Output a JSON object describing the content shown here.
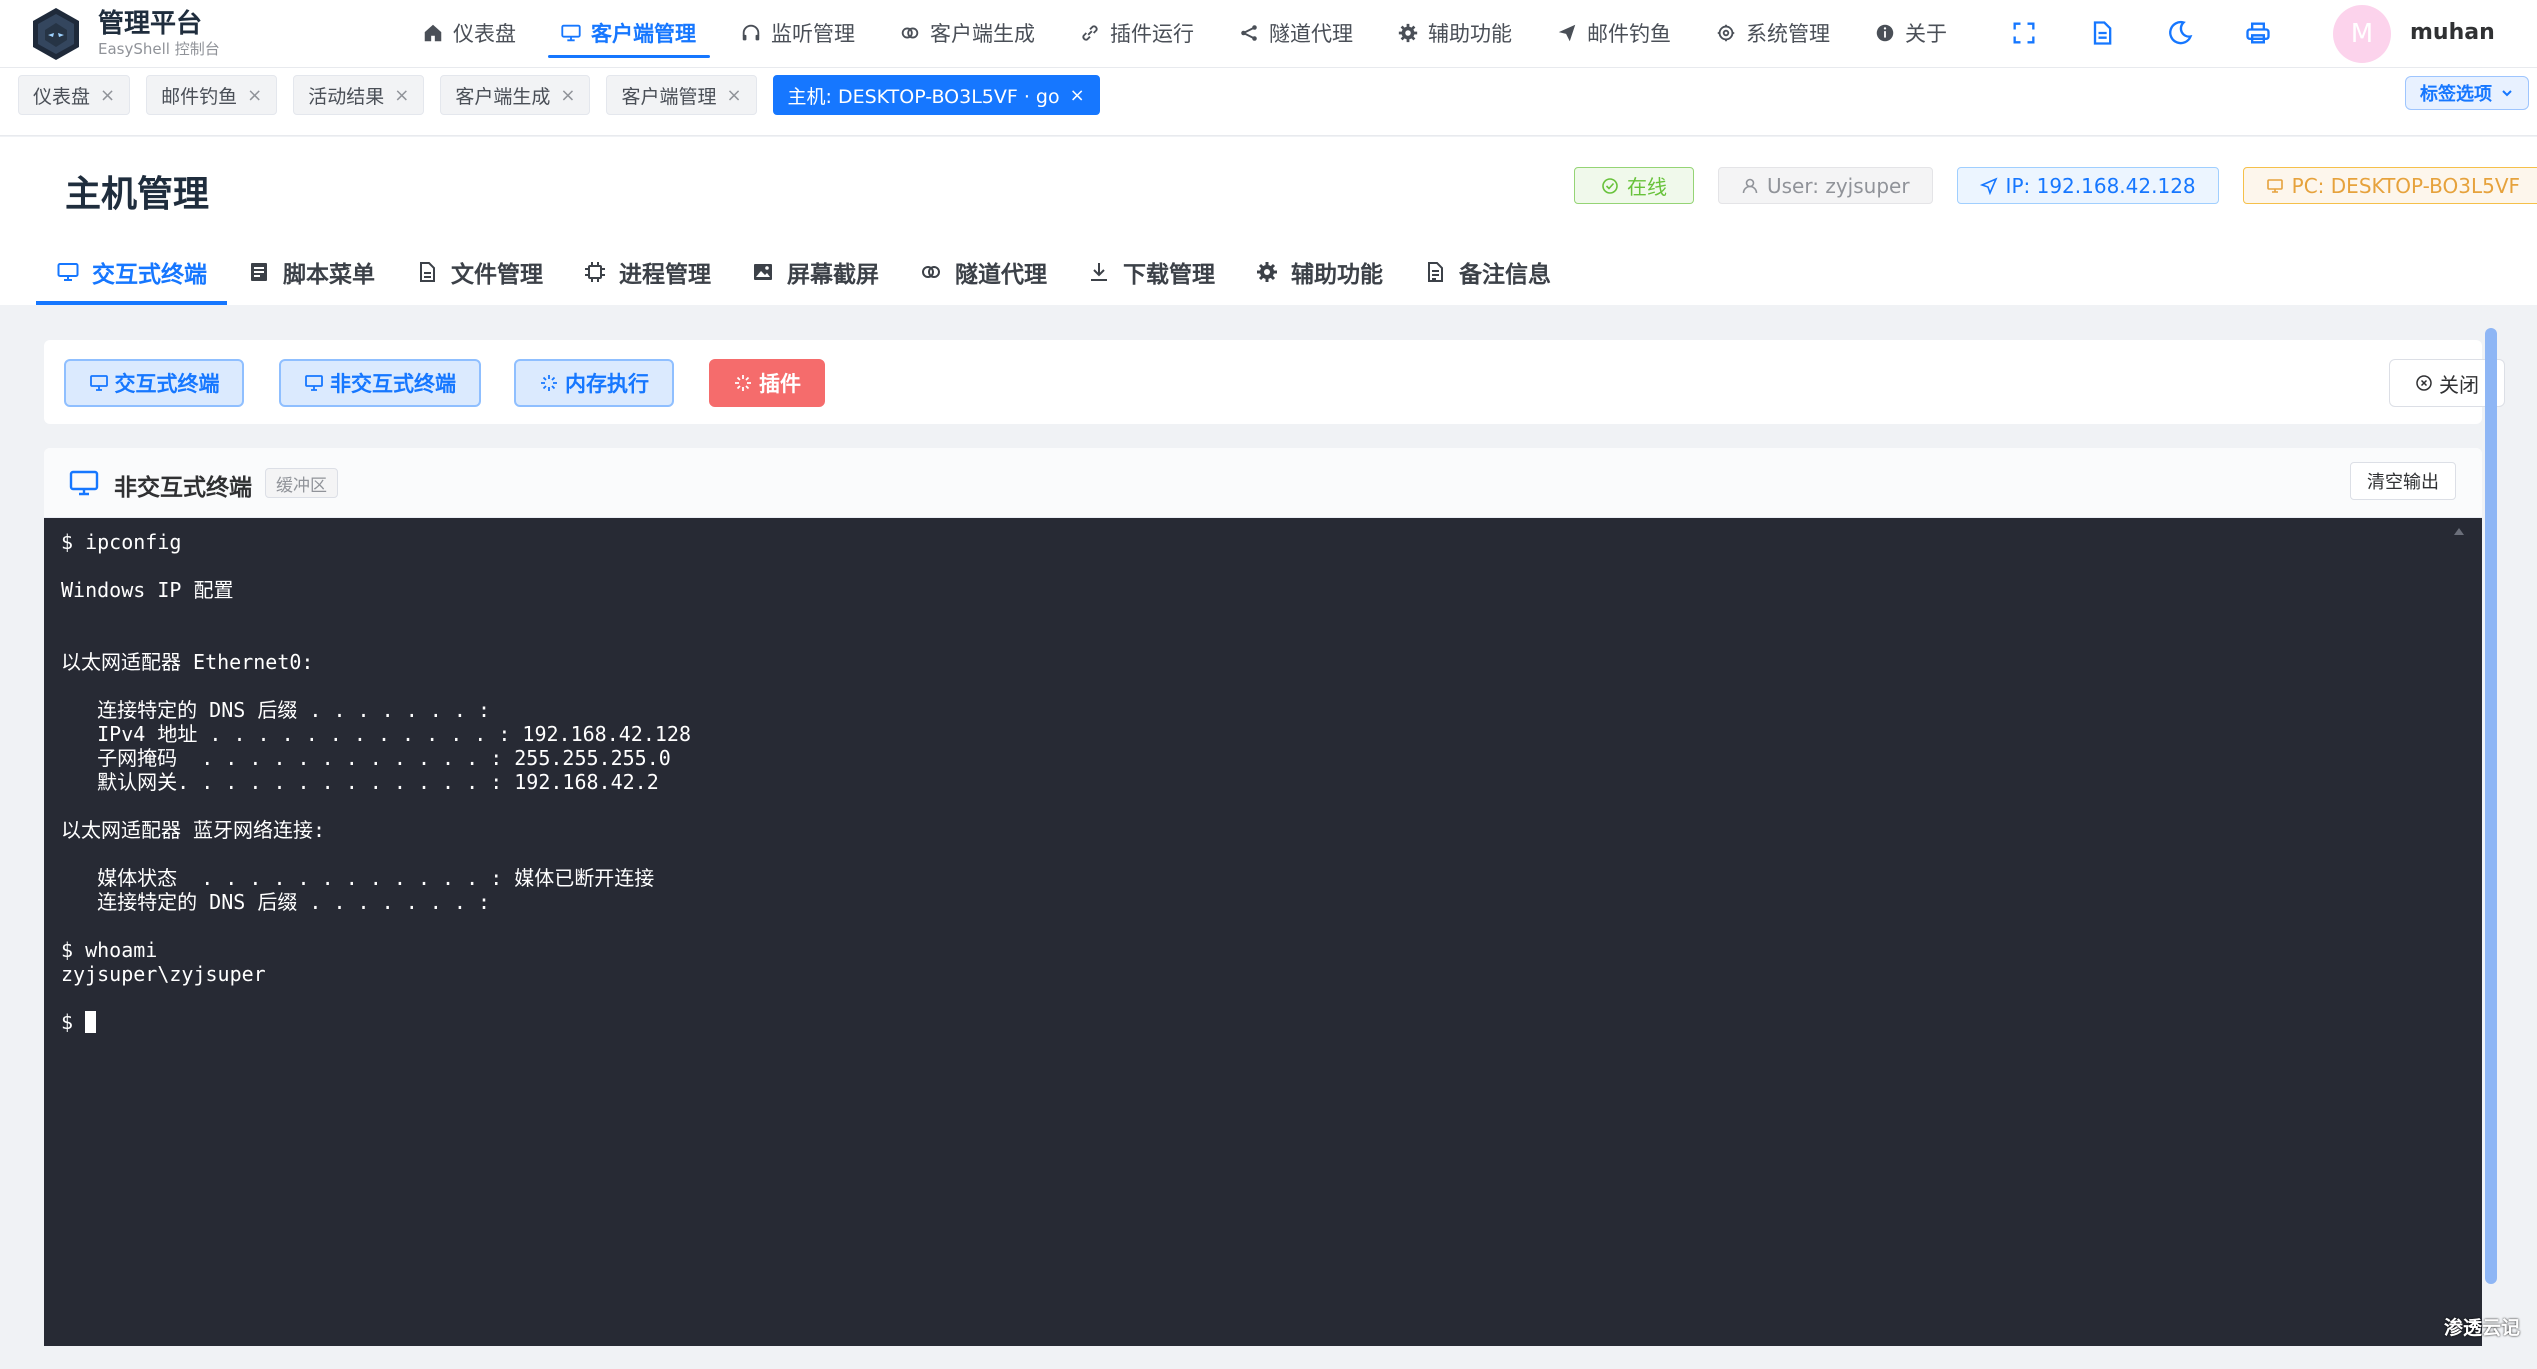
{
  "brand": {
    "title": "管理平台",
    "subtitle": "EasyShell 控制台"
  },
  "nav": [
    {
      "label": "仪表盘",
      "icon": "home-icon"
    },
    {
      "label": "客户端管理",
      "icon": "monitor-icon",
      "active": true
    },
    {
      "label": "监听管理",
      "icon": "headset-icon"
    },
    {
      "label": "客户端生成",
      "icon": "link-chain-icon"
    },
    {
      "label": "插件运行",
      "icon": "link-icon"
    },
    {
      "label": "隧道代理",
      "icon": "share-icon"
    },
    {
      "label": "辅助功能",
      "icon": "gear-icon"
    },
    {
      "label": "邮件钓鱼",
      "icon": "send-icon"
    },
    {
      "label": "系统管理",
      "icon": "settings-icon"
    },
    {
      "label": "关于",
      "icon": "info-icon"
    }
  ],
  "tools": [
    "fullscreen-icon",
    "document-icon",
    "moon-icon",
    "printer-icon"
  ],
  "user": {
    "avatar_letter": "M",
    "name": "muhan"
  },
  "tags": [
    {
      "label": "仪表盘"
    },
    {
      "label": "邮件钓鱼"
    },
    {
      "label": "活动结果"
    },
    {
      "label": "客户端生成"
    },
    {
      "label": "客户端管理"
    },
    {
      "label": "主机: DESKTOP-BO3L5VF · go",
      "active": true
    }
  ],
  "tags_options_label": "标签选项",
  "page": {
    "title": "主机管理",
    "status": "在线",
    "user": "User: zyjsuper",
    "ip": "IP: 192.168.42.128",
    "pc": "PC: DESKTOP-BO3L5VF"
  },
  "subtabs": [
    {
      "label": "交互式终端",
      "icon": "monitor-icon",
      "active": true
    },
    {
      "label": "脚本菜单",
      "icon": "script-icon"
    },
    {
      "label": "文件管理",
      "icon": "file-icon"
    },
    {
      "label": "进程管理",
      "icon": "cpu-icon"
    },
    {
      "label": "屏幕截屏",
      "icon": "image-icon"
    },
    {
      "label": "隧道代理",
      "icon": "link-chain-icon"
    },
    {
      "label": "下载管理",
      "icon": "download-icon"
    },
    {
      "label": "辅助功能",
      "icon": "gear-icon"
    },
    {
      "label": "备注信息",
      "icon": "note-icon"
    }
  ],
  "actions": {
    "interactive": "交互式终端",
    "noninteractive": "非交互式终端",
    "memory": "内存执行",
    "plugin": "插件",
    "close": "关闭"
  },
  "terminal": {
    "title": "非交互式终端",
    "buffer_tag": "缓冲区",
    "clear_label": "清空输出",
    "output": "$ ipconfig\n\nWindows IP 配置\n\n\n以太网适配器 Ethernet0:\n\n   连接特定的 DNS 后缀 . . . . . . . :\n   IPv4 地址 . . . . . . . . . . . . : 192.168.42.128\n   子网掩码  . . . . . . . . . . . . : 255.255.255.0\n   默认网关. . . . . . . . . . . . . : 192.168.42.2\n\n以太网适配器 蓝牙网络连接:\n\n   媒体状态  . . . . . . . . . . . . : 媒体已断开连接\n   连接特定的 DNS 后缀 . . . . . . . :\n\n$ whoami\nzyjsuper\\zyjsuper\n\n",
    "prompt": "$ "
  },
  "watermark": "渗透云记",
  "colors": {
    "primary": "#1677ff",
    "success": "#67c23a",
    "warning": "#e6a23c",
    "danger": "#f56c6c",
    "terminal_bg": "#272a34"
  }
}
